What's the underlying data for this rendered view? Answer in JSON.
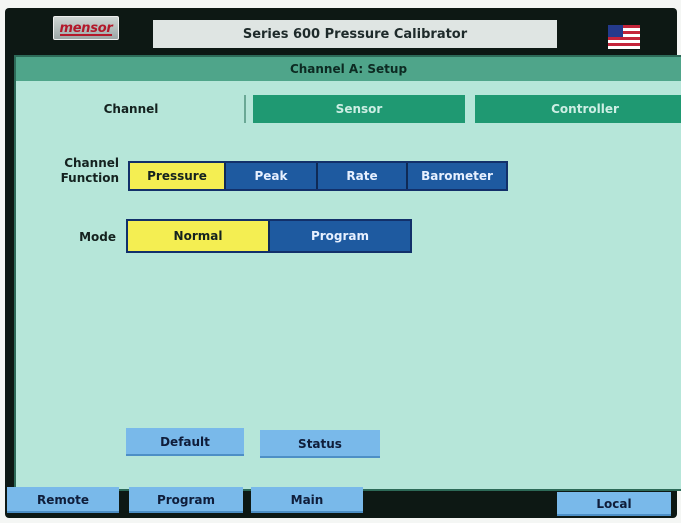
{
  "header": {
    "logo_text": "mensor",
    "title": "Series 600 Pressure Calibrator",
    "flag_icon": "us-flag-icon"
  },
  "panel": {
    "title": "Channel A: Setup",
    "tabs": [
      "Channel",
      "Sensor",
      "Controller"
    ],
    "active_tab": "Channel",
    "channel_function": {
      "label_line1": "Channel",
      "label_line2": "Function",
      "options": [
        "Pressure",
        "Peak",
        "Rate",
        "Barometer"
      ],
      "selected": "Pressure"
    },
    "mode": {
      "label": "Mode",
      "options": [
        "Normal",
        "Program"
      ],
      "selected": "Normal"
    },
    "buttons": {
      "default": "Default",
      "status": "Status"
    }
  },
  "footer": {
    "buttons": [
      "Remote",
      "Program",
      "Main",
      "Local"
    ]
  },
  "colors": {
    "panel_bg": "#b6e6d9",
    "header_bar": "#4fa58a",
    "tab_inactive": "#1f9972",
    "option_selected": "#f4ee52",
    "option_normal": "#1e5aa0",
    "button_light": "#79b9ea"
  }
}
